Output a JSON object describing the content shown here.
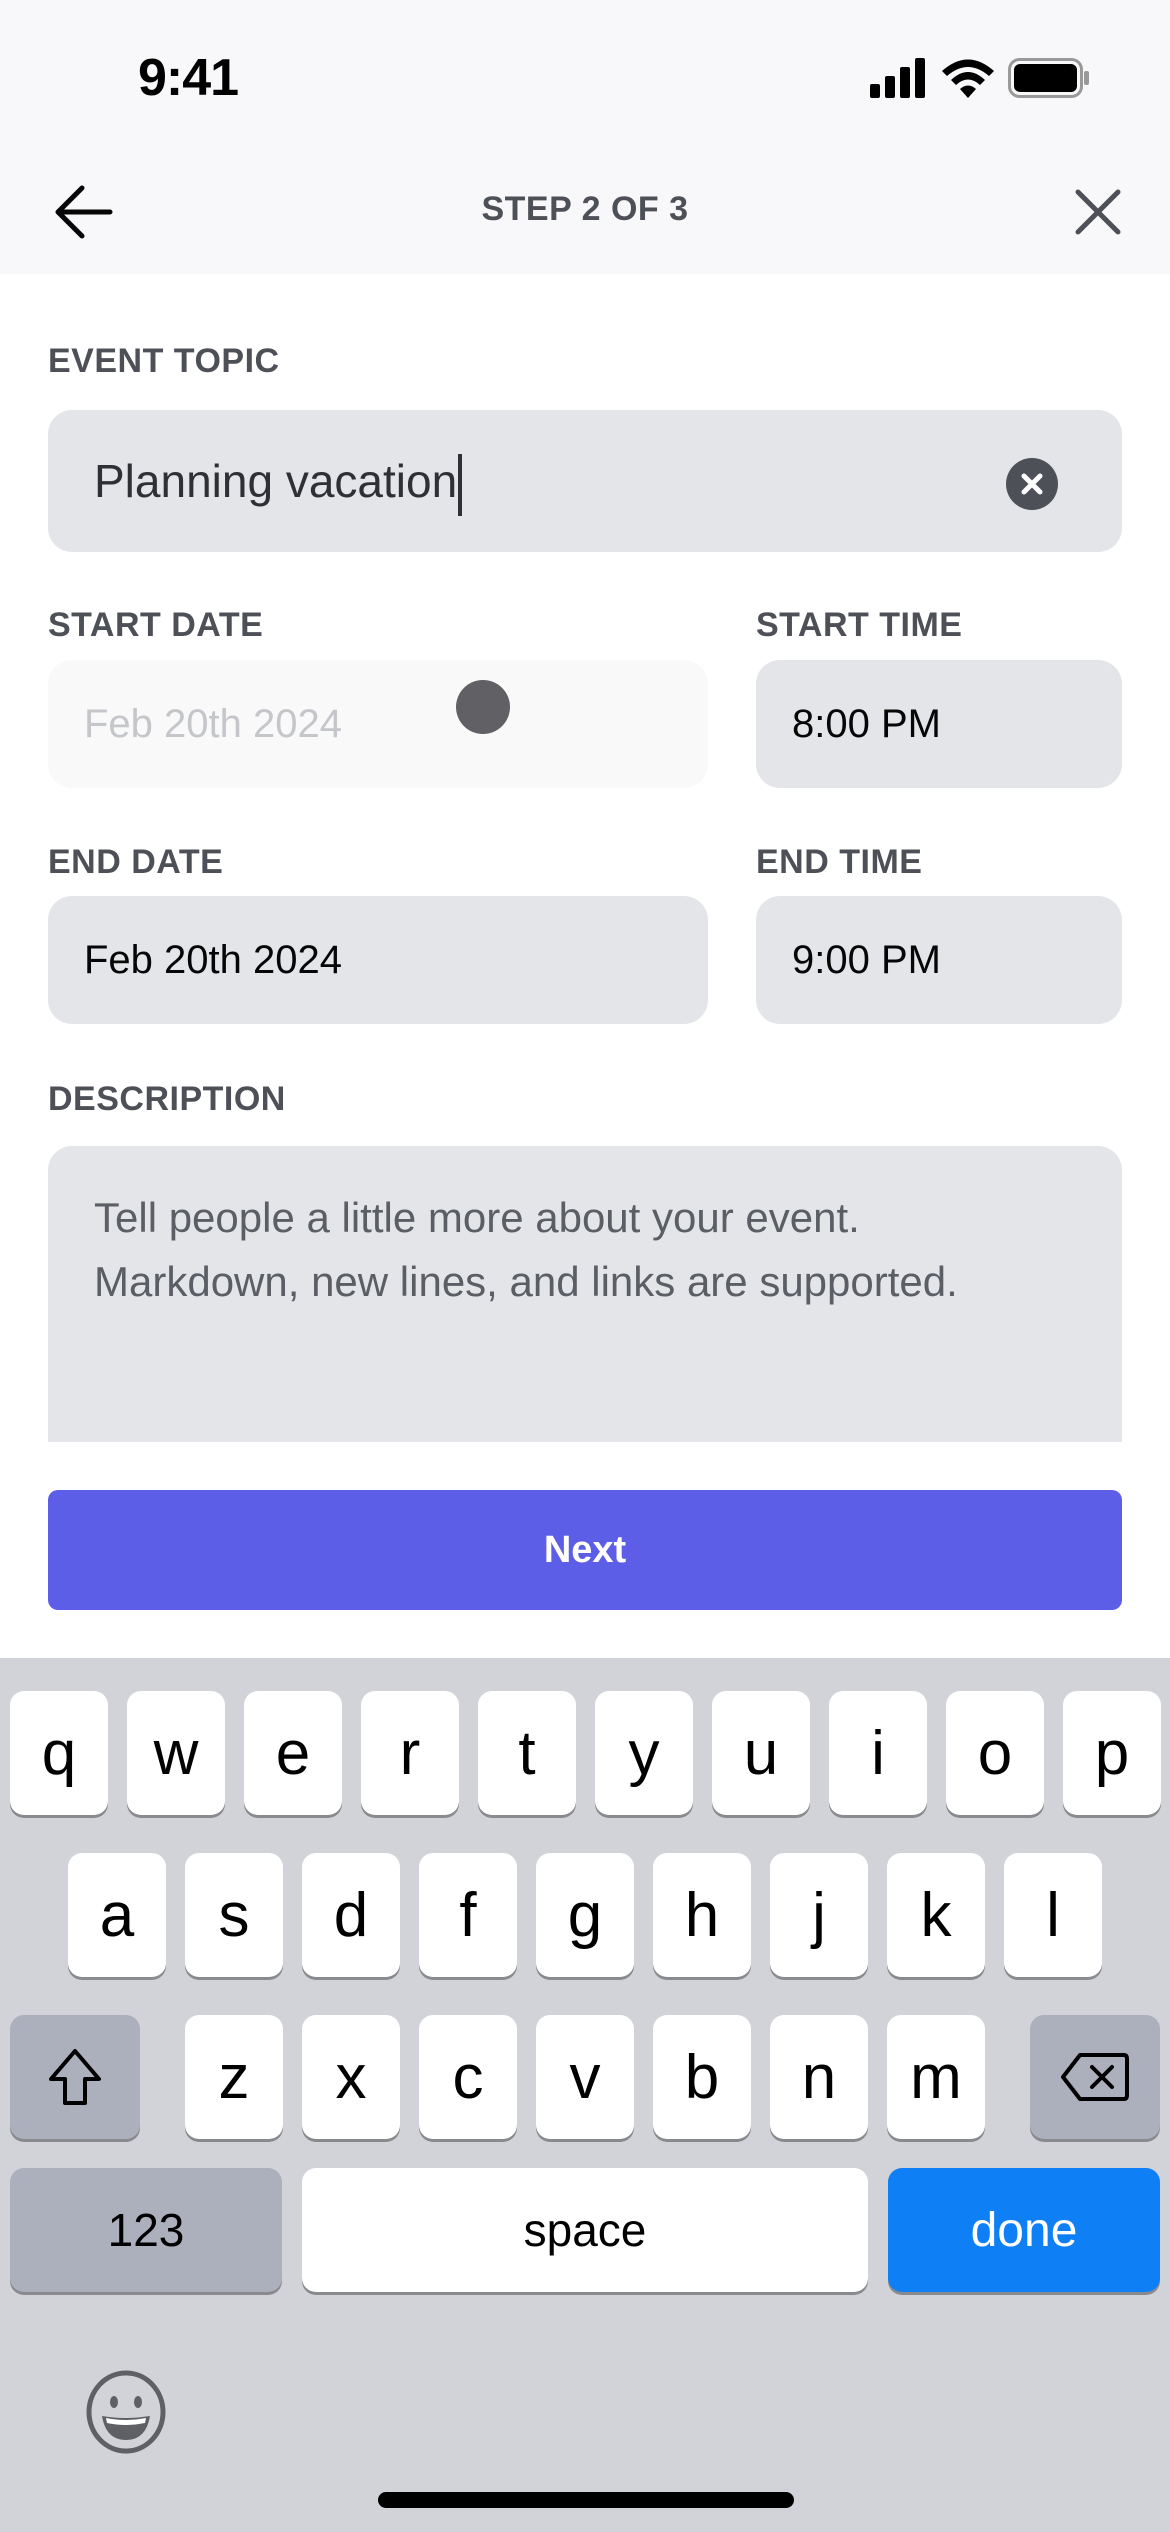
{
  "status_bar": {
    "time": "9:41"
  },
  "nav": {
    "title": "STEP 2 OF 3"
  },
  "form": {
    "event_topic": {
      "label": "EVENT TOPIC",
      "value": "Planning vacation"
    },
    "start_date": {
      "label": "START DATE",
      "value": "Feb 20th 2024"
    },
    "start_time": {
      "label": "START TIME",
      "value": "8:00 PM"
    },
    "end_date": {
      "label": "END DATE",
      "value": "Feb 20th 2024"
    },
    "end_time": {
      "label": "END TIME",
      "value": "9:00 PM"
    },
    "description": {
      "label": "DESCRIPTION",
      "placeholder_line1": "Tell people a little more about your event.",
      "placeholder_line2": "Markdown, new lines, and links are supported."
    },
    "next_label": "Next"
  },
  "keyboard": {
    "row1": [
      "q",
      "w",
      "e",
      "r",
      "t",
      "y",
      "u",
      "i",
      "o",
      "p"
    ],
    "row2": [
      "a",
      "s",
      "d",
      "f",
      "g",
      "h",
      "j",
      "k",
      "l"
    ],
    "row3": [
      "z",
      "x",
      "c",
      "v",
      "b",
      "n",
      "m"
    ],
    "numbers_label": "123",
    "space_label": "space",
    "done_label": "done"
  },
  "colors": {
    "accent": "#5d5ee8",
    "done_key": "#0f7ff5"
  }
}
